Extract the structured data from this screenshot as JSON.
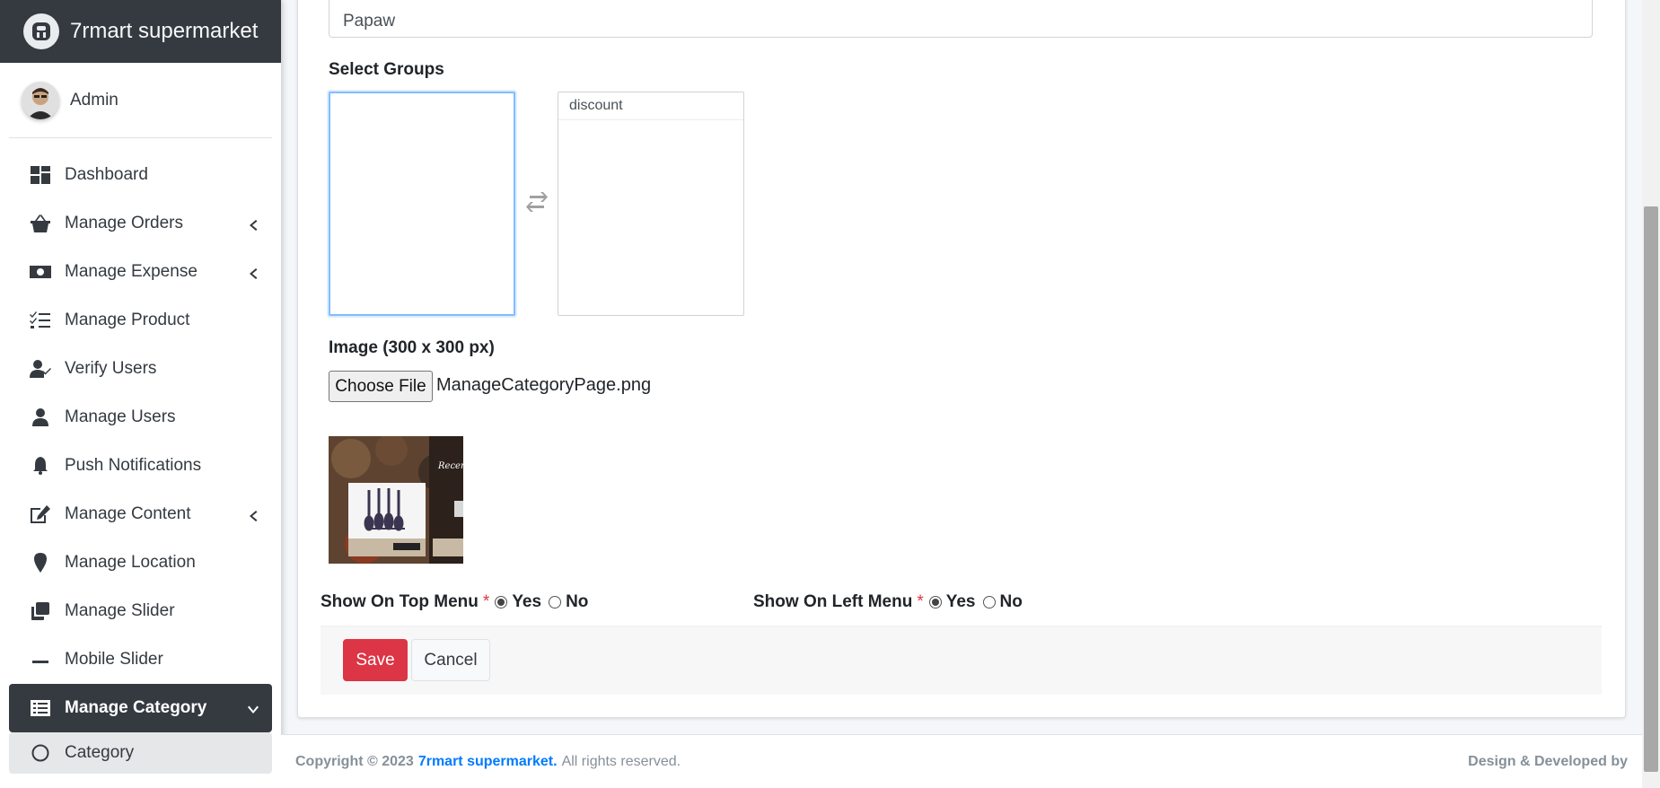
{
  "brand": {
    "name": "7rmart supermarket"
  },
  "user": {
    "name": "Admin"
  },
  "sidebar": {
    "items": [
      {
        "label": "Dashboard",
        "icon": "dashboard-icon"
      },
      {
        "label": "Manage Orders",
        "icon": "basket-icon",
        "has_submenu": true
      },
      {
        "label": "Manage Expense",
        "icon": "money-icon",
        "has_submenu": true
      },
      {
        "label": "Manage Product",
        "icon": "tasks-icon"
      },
      {
        "label": "Verify Users",
        "icon": "user-check-icon"
      },
      {
        "label": "Manage Users",
        "icon": "user-icon"
      },
      {
        "label": "Push Notifications",
        "icon": "bell-icon"
      },
      {
        "label": "Manage Content",
        "icon": "edit-icon",
        "has_submenu": true
      },
      {
        "label": "Manage Location",
        "icon": "map-marker-icon"
      },
      {
        "label": "Manage Slider",
        "icon": "clone-icon"
      },
      {
        "label": "Mobile Slider",
        "icon": "minus-icon"
      },
      {
        "label": "Manage Category",
        "icon": "list-icon",
        "expanded": true,
        "active": true
      }
    ],
    "subitems": [
      {
        "label": "Category",
        "icon": "circle-icon"
      }
    ]
  },
  "form": {
    "name_value": "Papaw",
    "select_groups_label": "Select Groups",
    "available_groups": [],
    "selected_groups": [
      "discount"
    ],
    "image_label": "Image (300 x 300 px)",
    "choose_file_label": "Choose File",
    "file_name": "ManageCategoryPage.png",
    "top_menu_label": "Show On Top Menu",
    "left_menu_label": "Show On Left Menu",
    "required_mark": "*",
    "yes_label": "Yes",
    "no_label": "No",
    "top_menu_value": "Yes",
    "left_menu_value": "Yes",
    "save_label": "Save",
    "cancel_label": "Cancel"
  },
  "footer": {
    "copyright": "Copyright © 2023",
    "company": "7rmart supermarket.",
    "rights": "All rights reserved.",
    "right_text": "Design & Developed by"
  },
  "colors": {
    "brand_bg": "#343a40",
    "save_button": "#dc3545",
    "link": "#007bff",
    "focus_border": "#80bdff"
  }
}
